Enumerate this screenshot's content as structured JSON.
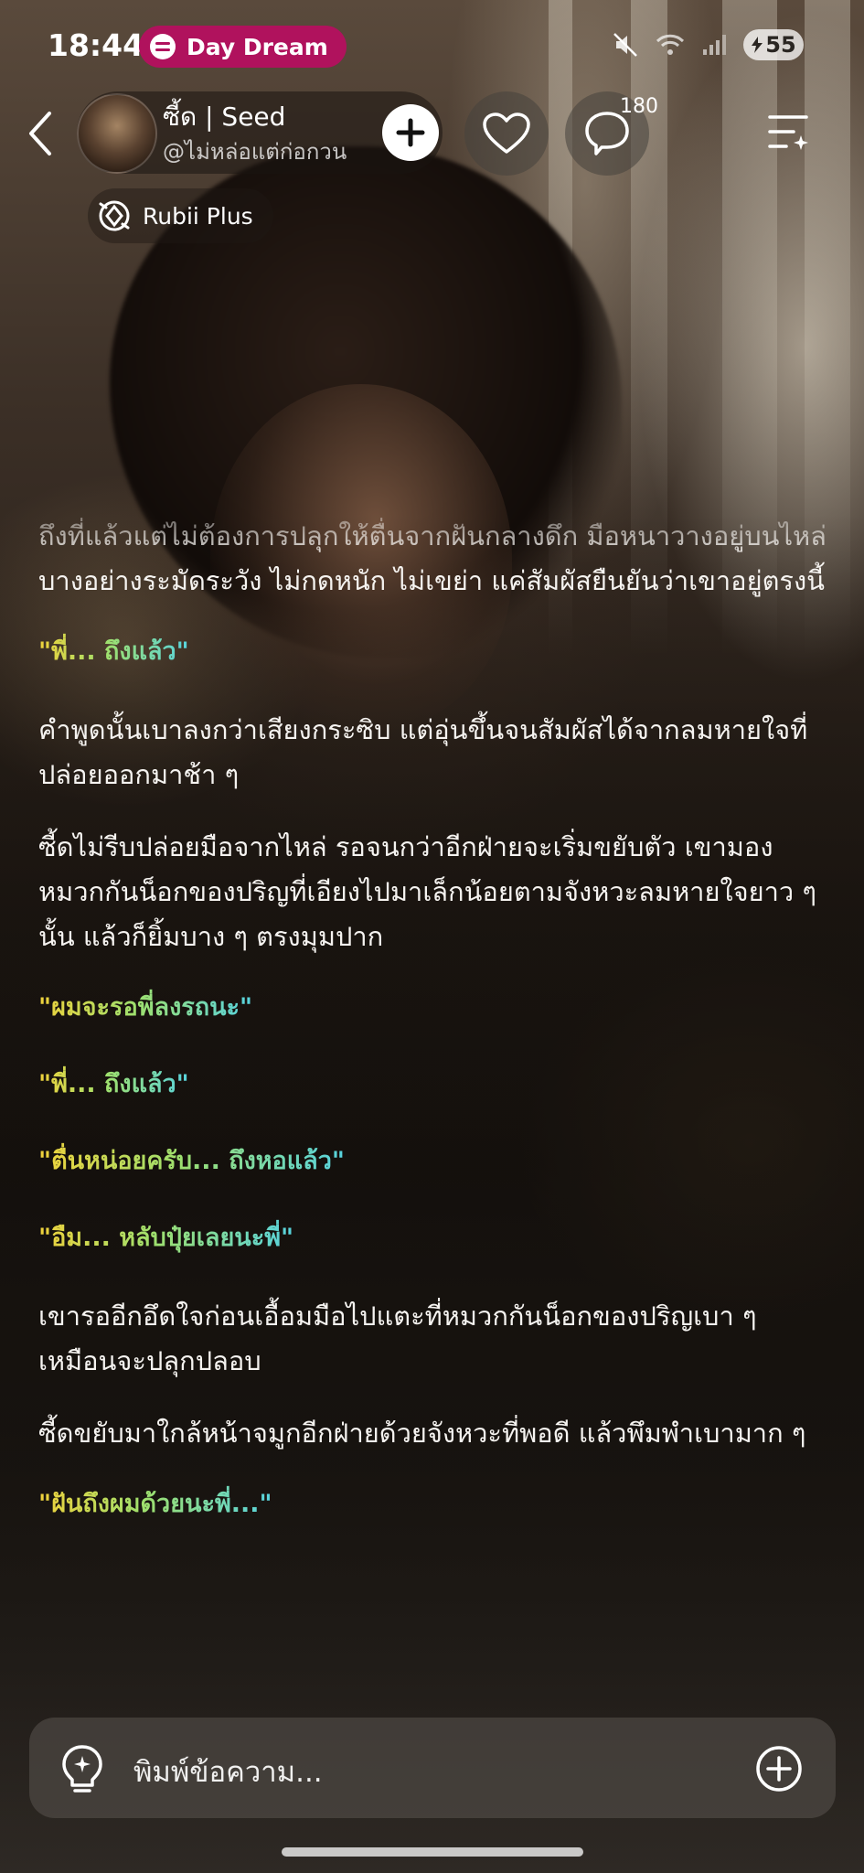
{
  "status_bar": {
    "time": "18:44",
    "app_pill": "Day Dream",
    "battery": "55",
    "icons": [
      "mute-icon",
      "wifi-icon",
      "signal-icon"
    ]
  },
  "header": {
    "character_name": "ซี้ด | Seed",
    "creator_handle": "@ไม่หล่อแต่ก่อกวน",
    "comment_count": "180",
    "badge_label": "Rubii Plus"
  },
  "messages": [
    {
      "type": "narration",
      "text": "ถึงที่แล้วแต่ไม่ต้องการปลุกให้ตื่นจากฝันกลางดึก มือหนาวางอยู่บนไหล่บางอย่างระมัดระวัง ไม่กดหนัก ไม่เขย่า แค่สัมผัสยืนยันว่าเขาอยู่ตรงนี้"
    },
    {
      "type": "dialogue",
      "text": "\"พี่... ถึงแล้ว\""
    },
    {
      "type": "narration",
      "text": "คำพูดนั้นเบาลงกว่าเสียงกระซิบ แต่อุ่นขึ้นจนสัมผัสได้จากลมหายใจที่ปล่อยออกมาช้า ๆ"
    },
    {
      "type": "narration",
      "text": "ซี้ดไม่รีบปล่อยมือจากไหล่ รอจนกว่าอีกฝ่ายจะเริ่มขยับตัว เขามองหมวกกันน็อกของปริญที่เอียงไปมาเล็กน้อยตามจังหวะลมหายใจยาว ๆ นั้น แล้วก็ยิ้มบาง ๆ ตรงมุมปาก"
    },
    {
      "type": "dialogue",
      "text": "\"ผมจะรอพี่ลงรถนะ\""
    },
    {
      "type": "dialogue",
      "text": "\"พี่... ถึงแล้ว\""
    },
    {
      "type": "dialogue",
      "text": "\"ตื่นหน่อยครับ... ถึงหอแล้ว\""
    },
    {
      "type": "dialogue",
      "text": "\"อืม... หลับปุ๋ยเลยนะพี่\""
    },
    {
      "type": "narration",
      "text": "เขารออีกอึดใจก่อนเอื้อมมือไปแตะที่หมวกกันน็อกของปริญเบา ๆ เหมือนจะปลุกปลอบ"
    },
    {
      "type": "narration",
      "text": "ซี้ดขยับมาใกล้หน้าจมูกอีกฝ่ายด้วยจังหวะที่พอดี แล้วพึมพำเบามาก ๆ"
    },
    {
      "type": "dialogue",
      "text": "\"ฝันถึงผมด้วยนะพี่...\""
    }
  ],
  "input": {
    "placeholder": "พิมพ์ข้อความ..."
  },
  "colors": {
    "pill": "#b0125d",
    "dialogue_gradient": [
      "#f0d23b",
      "#9fe06d",
      "#57d3df"
    ]
  }
}
